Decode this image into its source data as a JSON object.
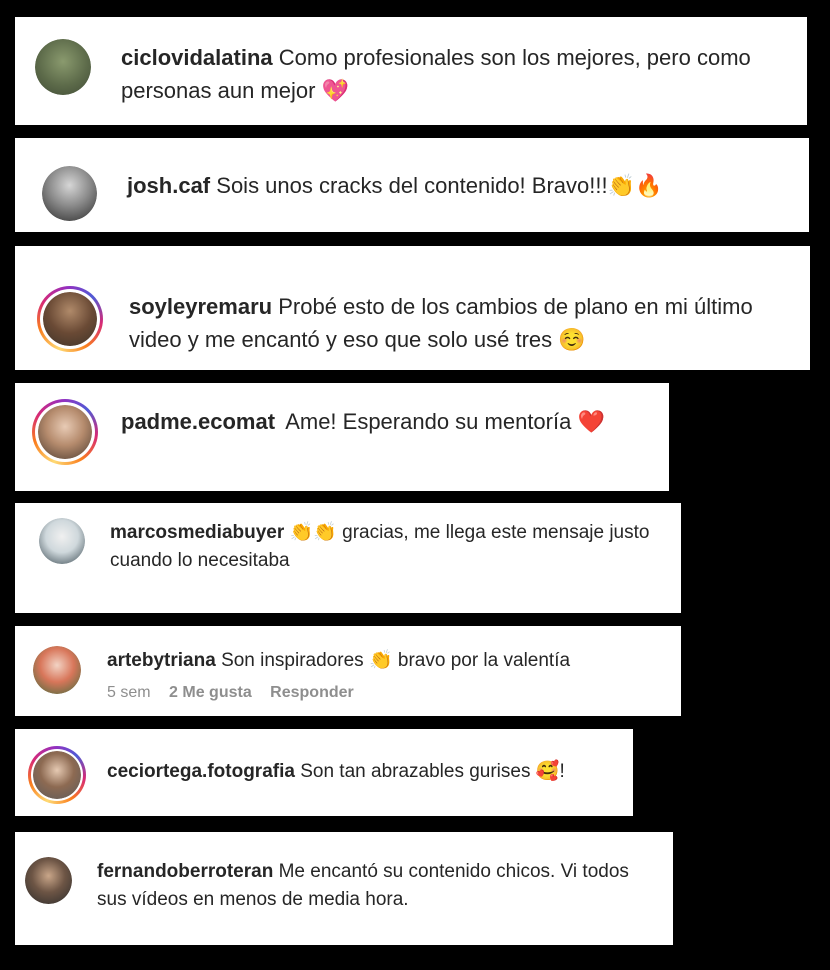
{
  "comments": [
    {
      "user": "ciclovidalatina",
      "text": "Como profesionales son los mejores, pero como personas aun mejor",
      "emoji": "💖"
    },
    {
      "user": "josh.caf",
      "text": "Sois unos cracks del contenido! Bravo!!!",
      "emoji": "👏🔥"
    },
    {
      "user": "soyleyremaru",
      "text": "Probé esto de los cambios de plano en mi último video y me encantó y eso que solo usé tres",
      "emoji": "☺️"
    },
    {
      "user": "padme.ecomat",
      "text": "Ame! Esperando su mentoría",
      "emoji": "❤️"
    },
    {
      "user": "marcosmediabuyer",
      "emoji_pre": "👏👏",
      "text": "gracias, me llega este mensaje justo cuando lo necesitaba"
    },
    {
      "user": "artebytriana",
      "text": "Son inspiradores",
      "emoji": "👏",
      "text2": "bravo por la valentía",
      "meta": {
        "time": "5 sem",
        "likes": "2 Me gusta",
        "reply": "Responder"
      }
    },
    {
      "user": "ceciortega.fotografia",
      "text": "Son tan abrazables gurises",
      "emoji": "🥰",
      "text2": "!"
    },
    {
      "user": "fernandoberroteran",
      "text": "Me encantó su contenido chicos. Vi todos sus vídeos en menos de media hora."
    }
  ],
  "colors": {
    "background": "#000000",
    "card": "#ffffff",
    "text": "#262626",
    "meta": "#8e8e8e"
  }
}
